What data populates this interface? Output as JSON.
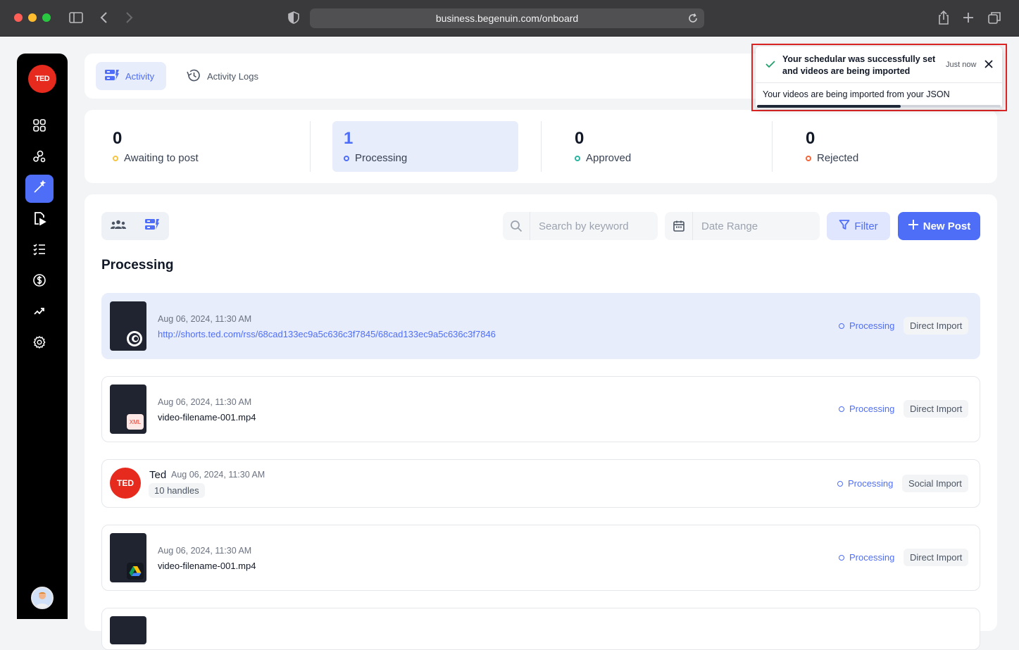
{
  "browser": {
    "url": "business.begenuin.com/onboard"
  },
  "sidebar": {
    "logo_text": "TED",
    "items": [
      {
        "icon": "grid-icon"
      },
      {
        "icon": "community-icon"
      },
      {
        "icon": "magic-wand-icon",
        "active": true
      },
      {
        "icon": "video-file-icon"
      },
      {
        "icon": "checklist-icon"
      },
      {
        "icon": "dollar-icon"
      },
      {
        "icon": "analytics-icon"
      },
      {
        "icon": "settings-icon"
      }
    ]
  },
  "tabs": [
    {
      "label": "Activity",
      "active": true
    },
    {
      "label": "Activity Logs",
      "active": false
    }
  ],
  "stats": [
    {
      "value": "0",
      "label": "Awaiting to post",
      "color": "#f5c542"
    },
    {
      "value": "1",
      "label": "Processing",
      "color": "#4f6ef7",
      "active": true
    },
    {
      "value": "0",
      "label": "Approved",
      "color": "#2bb5a0"
    },
    {
      "value": "0",
      "label": "Rejected",
      "color": "#f2683c"
    }
  ],
  "toolbar": {
    "search_placeholder": "Search by keyword",
    "date_placeholder": "Date Range",
    "filter_label": "Filter",
    "new_post_label": "New Post"
  },
  "section_title": "Processing",
  "rows": [
    {
      "date": "Aug 06, 2024, 11:30 AM",
      "text": "http://shorts.ted.com/rss/68cad133ec9a5c636c3f7845/68cad133ec9a5c636c3f7846",
      "status": "Processing",
      "type": "Direct Import",
      "badge": "rss-icon"
    },
    {
      "date": "Aug 06, 2024, 11:30 AM",
      "text": "video-filename-001.mp4",
      "status": "Processing",
      "type": "Direct Import",
      "badge": "xml-icon",
      "badge_text": "XML"
    },
    {
      "name": "Ted",
      "date": "Aug 06, 2024, 11:30 AM",
      "handles": "10 handles",
      "status": "Processing",
      "type": "Social Import",
      "avatar_text": "TED"
    },
    {
      "date": "Aug 06, 2024, 11:30 AM",
      "text": "video-filename-001.mp4",
      "status": "Processing",
      "type": "Direct Import",
      "badge": "google-drive-icon"
    }
  ],
  "toast": {
    "title": "Your schedular was successfully set and videos are being imported",
    "time": "Just now",
    "message": "Your videos are being imported from your JSON",
    "progress": 0.59
  },
  "colors": {
    "accent": "#4f6ef7",
    "ted_red": "#e62b1e",
    "toast_outline": "#e02424"
  }
}
